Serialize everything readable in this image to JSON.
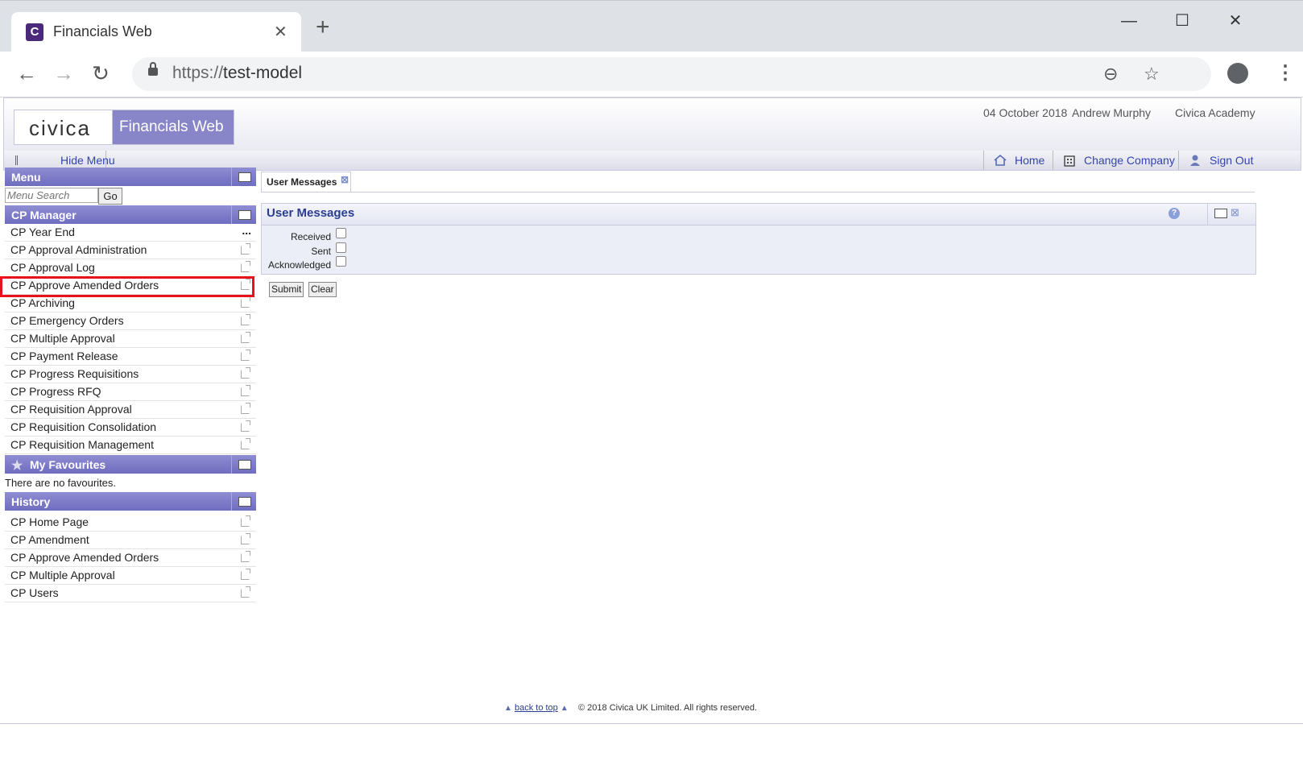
{
  "browser": {
    "tab_title": "Financials Web",
    "tab_favicon": "C",
    "url_scheme": "https://",
    "url_host": "test-model"
  },
  "header": {
    "logo": "civica",
    "product": "Financials Web",
    "date": "04 October 2018",
    "user": "Andrew Murphy",
    "company": "Civica Academy"
  },
  "menubar": {
    "hide_menu": "Hide Menu",
    "home": "Home",
    "change_company": "Change Company",
    "sign_out": "Sign Out"
  },
  "menu": {
    "title": "Menu",
    "search_placeholder": "Menu Search",
    "go": "Go"
  },
  "cp_manager": {
    "title": "CP Manager",
    "items": [
      {
        "label": "CP Year End"
      },
      {
        "label": "CP Approval Administration"
      },
      {
        "label": "CP Approval Log"
      },
      {
        "label": "CP Approve Amended Orders"
      },
      {
        "label": "CP Archiving"
      },
      {
        "label": "CP Emergency Orders"
      },
      {
        "label": "CP Multiple Approval"
      },
      {
        "label": "CP Payment Release"
      },
      {
        "label": "CP Progress Requisitions"
      },
      {
        "label": "CP Progress RFQ"
      },
      {
        "label": "CP Requisition Approval"
      },
      {
        "label": "CP Requisition Consolidation"
      },
      {
        "label": "CP Requisition Management"
      }
    ]
  },
  "favourites": {
    "title": "My Favourites",
    "empty": "There are no favourites."
  },
  "history": {
    "title": "History",
    "items": [
      {
        "label": "CP Home Page"
      },
      {
        "label": "CP Amendment"
      },
      {
        "label": "CP Approve Amended Orders"
      },
      {
        "label": "CP Multiple Approval"
      },
      {
        "label": "CP Users"
      }
    ]
  },
  "main": {
    "tab_label": "User Messages",
    "panel_title": "User Messages",
    "fields": [
      {
        "label": "Received"
      },
      {
        "label": "Sent"
      },
      {
        "label": "Acknowledged"
      }
    ],
    "submit": "Submit",
    "clear": "Clear"
  },
  "footer": {
    "back_to_top": "back to top",
    "copyright": "© 2018 Civica UK Limited. All rights reserved."
  },
  "colors": {
    "panel_header": "#7b79c8",
    "highlight": "#e8121d",
    "link": "#3344aa"
  }
}
